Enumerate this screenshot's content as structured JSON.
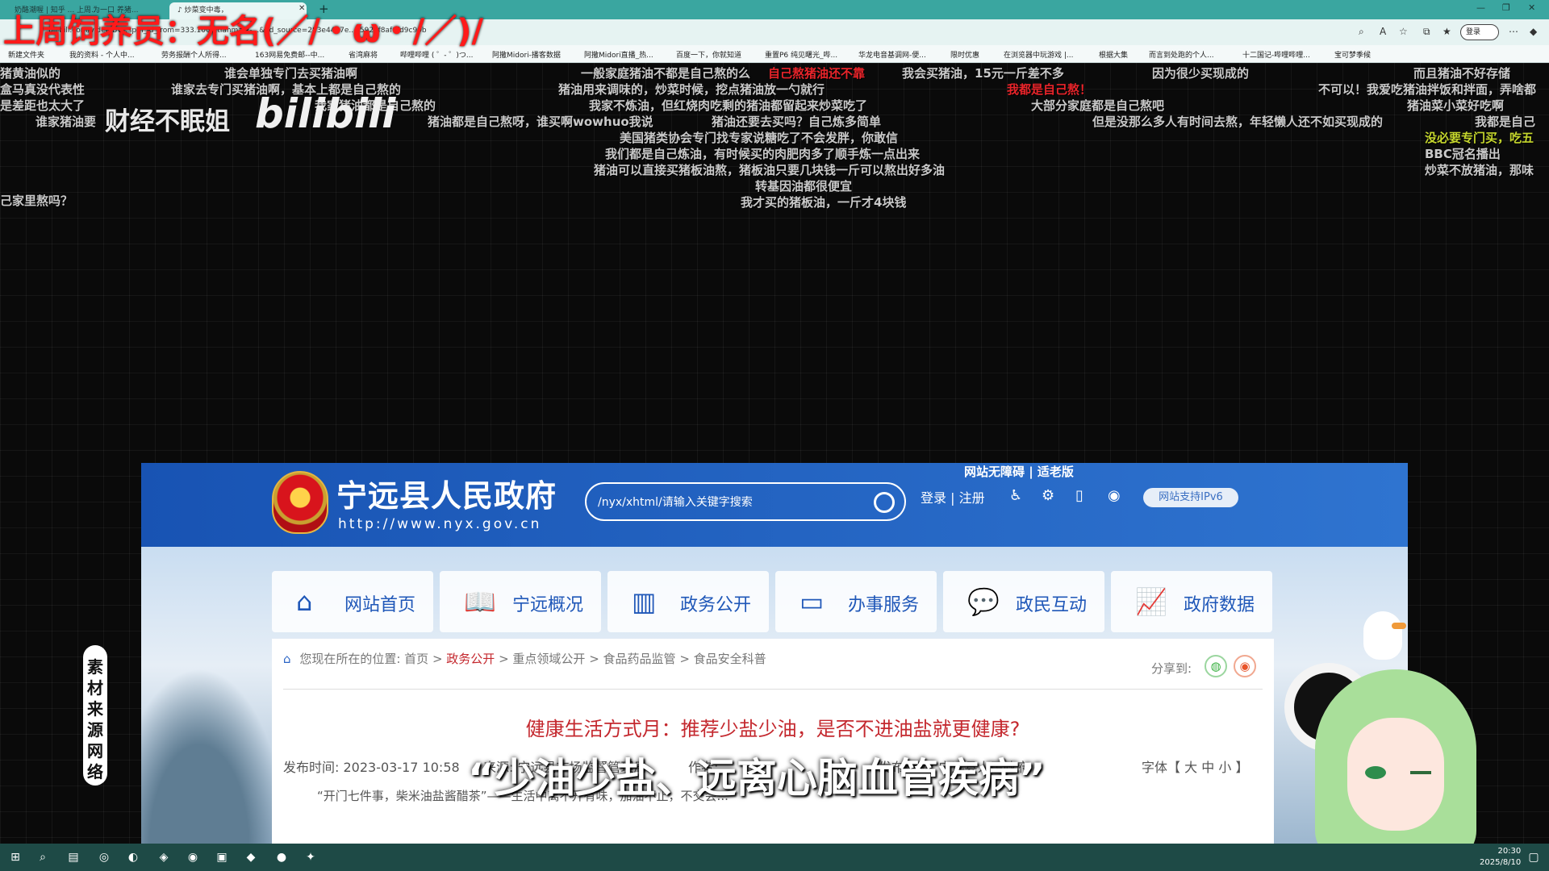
{
  "browser": {
    "tabs": [
      {
        "label": "奶酪潮喔 | 知乎 ... 上周..."
      },
      {
        "label": "为一口 养猪..."
      },
      {
        "label": "炒菜变中毒，"
      }
    ],
    "url": "bilibili.com/video/BV...spm_id_from=333.1007.tianma.2-...&vd_source=283e4467e...c592af8af0fd9c99b",
    "login_label": "登录",
    "bookmarks": [
      "新建文件夹",
      "我的资料 - 个人中...",
      "劳务报酬个人所得...",
      "163网易免费邮--中...",
      "省湾麻将",
      "哔哩哔哩 ( ゜- ゜)つ...",
      "阿撒Midori-播客数据",
      "阿撒Midori直播_热...",
      "百度一下，你就知道",
      "重置P6 纯见曙光_哔...",
      "华龙电音基调网-便...",
      "限时优惠",
      "在浏览器中玩游戏 |...",
      "根据大集",
      "而言到处跑的个人...",
      "十二国记-哔哩哔哩...",
      "宝可梦季候"
    ]
  },
  "overlay": {
    "title": "上周饲养员：无名(／/・ω・/／)/",
    "channel_name": "财经不眠姐",
    "bili_logo": "bilibili",
    "subtitle": "“少油少盐、远离心脑血管疾病”",
    "source_note": "素材来源网络"
  },
  "danmaku": [
    {
      "text": "猪黄油似的",
      "color": "gray"
    },
    {
      "text": "盒马真没代表性",
      "color": "gray"
    },
    {
      "text": "是差距也太大了",
      "color": "gray"
    },
    {
      "text": "谁家猪油要",
      "color": "gray"
    },
    {
      "text": "谁会单独专门去买猪油啊",
      "color": "gray"
    },
    {
      "text": "谁家去专门买猪油啊，基本上都是自己熬的",
      "color": "gray"
    },
    {
      "text": "我家猪油都是自己熬的",
      "color": "gray"
    },
    {
      "text": "猪油都是自己熬呀，谁买啊wowhuo我说",
      "color": "gray"
    },
    {
      "text": "一般家庭猪油不都是自己熬的么",
      "color": "gray"
    },
    {
      "text": "自己熬猪油还不靠",
      "color": "red"
    },
    {
      "text": "我会买猪油，15元一斤差不多",
      "color": "gray"
    },
    {
      "text": "猪油用来调味的，炒菜时候，挖点猪油放一勺就行",
      "color": "gray"
    },
    {
      "text": "我家不炼油，但红烧肉吃剩的猪油都留起来炒菜吃了",
      "color": "gray"
    },
    {
      "text": "猪油还要去买吗？自己炼多简单",
      "color": "gray"
    },
    {
      "text": "美国猪类协会专门找专家说糖吃了不会发胖，你敢信",
      "color": "gray"
    },
    {
      "text": "我们都是自己炼油，有时候买的肉肥肉多了顺手炼一点出来",
      "color": "gray"
    },
    {
      "text": "猪油可以直接买猪板油熬，猪板油只要几块钱一斤可以熬出好多油",
      "color": "gray"
    },
    {
      "text": "转基因油都很便宜",
      "color": "gray"
    },
    {
      "text": "我才买的猪板油，一斤才4块钱",
      "color": "gray"
    },
    {
      "text": "我都是自己熬！",
      "color": "red"
    },
    {
      "text": "大部分家庭都是自己熬吧",
      "color": "gray"
    },
    {
      "text": "因为很少买现成的",
      "color": "gray"
    },
    {
      "text": "但是没那么多人有时间去熬，年轻懒人还不如买现成的",
      "color": "gray"
    },
    {
      "text": "而且猪油不好存储",
      "color": "gray"
    },
    {
      "text": "不可以！我爱吃猪油拌饭和拌面，弄啥都",
      "color": "gray"
    },
    {
      "text": "猪油菜小菜好吃啊",
      "color": "gray"
    },
    {
      "text": "我都是自己",
      "color": "gray"
    },
    {
      "text": "没必要专门买，吃五",
      "color": "yellow"
    },
    {
      "text": "BBC冠名播出",
      "color": "gray"
    },
    {
      "text": "炒菜不放猪油，那味",
      "color": "gray"
    },
    {
      "text": "己家里熬吗？",
      "color": "gray"
    }
  ],
  "gov_site": {
    "access_links": "网站无障碍 | 适老版",
    "title": "宁远县人民政府",
    "url": "http://www.nyx.gov.cn",
    "search_placeholder": "/nyx/xhtml/请输入关键字搜索",
    "login": "登录",
    "separator": "|",
    "register": "注册",
    "ipv6": "网站支持IPv6",
    "nav": [
      {
        "label": "网站首页",
        "icon": "home-icon"
      },
      {
        "label": "宁远概况",
        "icon": "book-icon"
      },
      {
        "label": "政务公开",
        "icon": "columns-icon"
      },
      {
        "label": "办事服务",
        "icon": "monitor-icon"
      },
      {
        "label": "政民互动",
        "icon": "chat-icon"
      },
      {
        "label": "政府数据",
        "icon": "chart-icon"
      }
    ],
    "breadcrumb": {
      "prefix": "您现在所在的位置:",
      "items": [
        "首页",
        "政务公开",
        "重点领域公开",
        "食品药品监管",
        "食品安全科普"
      ],
      "active_index": 1
    },
    "share_label": "分享到:",
    "article": {
      "title": "健康生活方式月：推荐少盐少油，是否不进油盐就更健康?",
      "publish_label": "发布时间:",
      "publish_time": "2023-03-17 10:58",
      "source_label": "来源:",
      "source": "宁远县市场监督管理局",
      "author_label": "作者:",
      "org_label": "发布机构:",
      "org": "宁远县人民政府",
      "font_label": "字体【",
      "font_large": "大",
      "font_medium": "中",
      "font_small": "小",
      "font_end": "】",
      "intro": "“开门七件事，柴米油盐酱醋茶”——生活中离不开有味，加油不止，不交会..."
    }
  },
  "taskbar": {
    "time": "20:30",
    "date": "2025/8/10"
  },
  "colors": {
    "header_blue": "#1853b3",
    "nav_blue": "#1f57b8",
    "article_red": "#c4282e",
    "overlay_red": "#ff1a1a",
    "browser_teal": "#3aa6a0"
  }
}
